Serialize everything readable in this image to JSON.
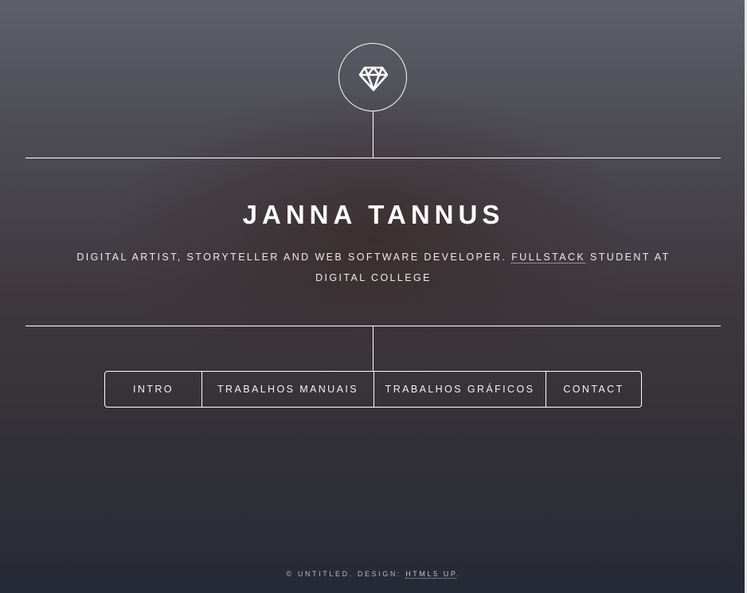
{
  "header": {
    "logo_icon": "diamond-icon",
    "name": "JANNA TANNUS",
    "subtitle": {
      "before": "DIGITAL ARTIST, STORYTELLER AND WEB SOFTWARE DEVELOPER. ",
      "link": "FULLSTACK",
      "after": " STUDENT AT DIGITAL COLLEGE"
    }
  },
  "nav": {
    "items": [
      {
        "label": "INTRO"
      },
      {
        "label": "TRABALHOS MANUAIS"
      },
      {
        "label": "TRABALHOS GRÁFICOS"
      },
      {
        "label": "CONTACT"
      }
    ]
  },
  "footer": {
    "text_before": "© UNTITLED. DESIGN: ",
    "link": "HTML5 UP",
    "text_after": "."
  },
  "colors": {
    "text": "#ffffff",
    "background_top": "#5d606a",
    "background_bottom": "#262a36"
  }
}
